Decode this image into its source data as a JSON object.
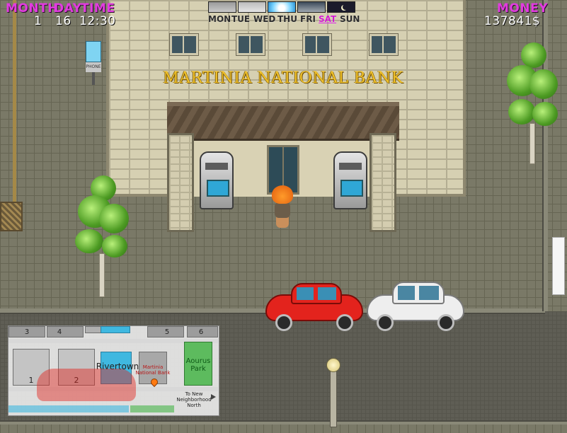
{
  "hud": {
    "labels": {
      "month": "MONTH",
      "day": "DAY",
      "time": "TIME",
      "money": "MONEY"
    },
    "month": "1",
    "day": "16",
    "time": "12:30",
    "money": "137841$",
    "weather_icons": [
      "cloud-icon",
      "cloud-icon",
      "sun-icon",
      "cloud-icon",
      "moon-icon"
    ],
    "weekdays": [
      "MON",
      "TUE",
      "WED",
      "THU",
      "FRI",
      "SAT",
      "SUN"
    ],
    "current_weekday": "SAT"
  },
  "scene": {
    "bank_sign": "MARTINIA NATIONAL BANK",
    "phone_label": "PHONE"
  },
  "minimap": {
    "plot_numbers": [
      "3",
      "4",
      "5",
      "6",
      "1",
      "2"
    ],
    "town_label": "Rivertown",
    "bank_label": "Martinia National Bank",
    "park_label": "Aourus Park",
    "exit_label": "To New Neighborhood North"
  },
  "colors": {
    "hud_label": "#e23be0",
    "hud_value": "#ffffff",
    "car_red": "#e3231d",
    "car_white": "#eeeeee",
    "park_green": "#5dbb5e",
    "town_blue": "#3fb8e0"
  }
}
